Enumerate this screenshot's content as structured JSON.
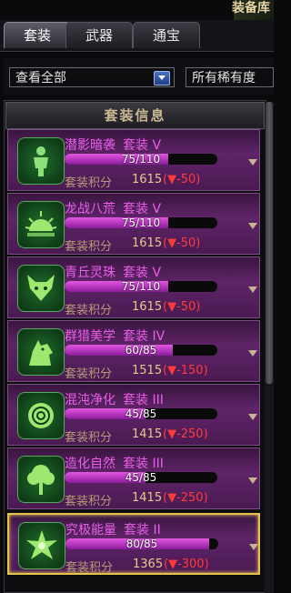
{
  "window": {
    "title": "装备库"
  },
  "tabs": [
    {
      "label": "套装"
    },
    {
      "label": "武器"
    },
    {
      "label": "通宝"
    }
  ],
  "filters": {
    "view": "查看全部",
    "rarity": "所有稀有度"
  },
  "section": {
    "title": "套装信息"
  },
  "score_label": "套装积分",
  "items": [
    {
      "name": "潜影暗袭",
      "suffix": "套装 V",
      "progress": "75/110",
      "fill": 0.68,
      "score": "1615",
      "delta": "(▼-50)",
      "icon": "body-silhouette-icon"
    },
    {
      "name": "龙战八荒",
      "suffix": "套装 V",
      "progress": "75/110",
      "fill": 0.68,
      "score": "1615",
      "delta": "(▼-50)",
      "icon": "rising-sun-icon"
    },
    {
      "name": "青丘灵珠",
      "suffix": "套装 V",
      "progress": "75/110",
      "fill": 0.68,
      "score": "1615",
      "delta": "(▼-50)",
      "icon": "fox-icon"
    },
    {
      "name": "群猎美学",
      "suffix": "套装 IV",
      "progress": "60/85",
      "fill": 0.71,
      "score": "1515",
      "delta": "(▼-150)",
      "icon": "wolf-icon"
    },
    {
      "name": "混沌净化",
      "suffix": "套装 III",
      "progress": "45/85",
      "fill": 0.53,
      "score": "1415",
      "delta": "(▼-250)",
      "icon": "rose-icon"
    },
    {
      "name": "造化自然",
      "suffix": "套装 III",
      "progress": "45/85",
      "fill": 0.53,
      "score": "1415",
      "delta": "(▼-250)",
      "icon": "tree-icon"
    },
    {
      "name": "究极能量",
      "suffix": "套装 II",
      "progress": "80/85",
      "fill": 0.94,
      "score": "1365",
      "delta": "(▼-300)",
      "icon": "energy-star-icon"
    }
  ],
  "colors": {
    "accent": "#ea5fea",
    "score": "#e9c989",
    "delta": "#ff3b3b",
    "selected_border": "#e6c34a"
  }
}
